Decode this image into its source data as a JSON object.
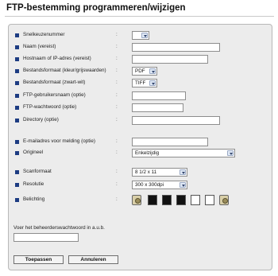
{
  "page": {
    "title": "FTP-bestemming programmeren/wijzigen"
  },
  "form": {
    "fields": [
      {
        "label": "Snelkeuzenummer",
        "type": "select",
        "value": ""
      },
      {
        "label": "Naam (vereist)",
        "type": "input",
        "value": ""
      },
      {
        "label": "Hostnaam of IP-adres (vereist)",
        "type": "input",
        "value": ""
      },
      {
        "label": "Bestandsformaat (kleur/grijswaarden)",
        "type": "select",
        "value": "PDF"
      },
      {
        "label": "Bestandsformaat (zwart-wit)",
        "type": "select",
        "value": "TIFF"
      },
      {
        "label": "FTP-gebruikersnaam (optie)",
        "type": "input",
        "value": ""
      },
      {
        "label": "FTP-wachtwoord (optie)",
        "type": "input",
        "value": ""
      },
      {
        "label": "Directory (optie)",
        "type": "input",
        "value": ""
      },
      {
        "label": "E-mailadres voor melding (optie)",
        "type": "input",
        "value": ""
      },
      {
        "label": "Origineel",
        "type": "select",
        "value": "Enkelzijdig"
      },
      {
        "label": "Scanformaat",
        "type": "select",
        "value": "8 1/2 x 11"
      },
      {
        "label": "Resolutie",
        "type": "select",
        "value": "300 x 300dpi"
      },
      {
        "label": "Belichting",
        "type": "exposure",
        "value": ""
      }
    ],
    "colon": ":",
    "exposure_icons": [
      "exposure-lighter-icon",
      "exposure-level-icon",
      "exposure-level-icon",
      "exposure-level-icon",
      "exposure-level-icon",
      "exposure-level-icon",
      "exposure-darker-icon"
    ]
  },
  "admin": {
    "password_label": "Voer het beheerderswachtwoord in a.u.b.",
    "password_value": ""
  },
  "buttons": {
    "apply": "Toepassen",
    "cancel": "Annuleren"
  },
  "colors": {
    "bullet": "#1d3c82",
    "panel_background": "#ececec"
  }
}
